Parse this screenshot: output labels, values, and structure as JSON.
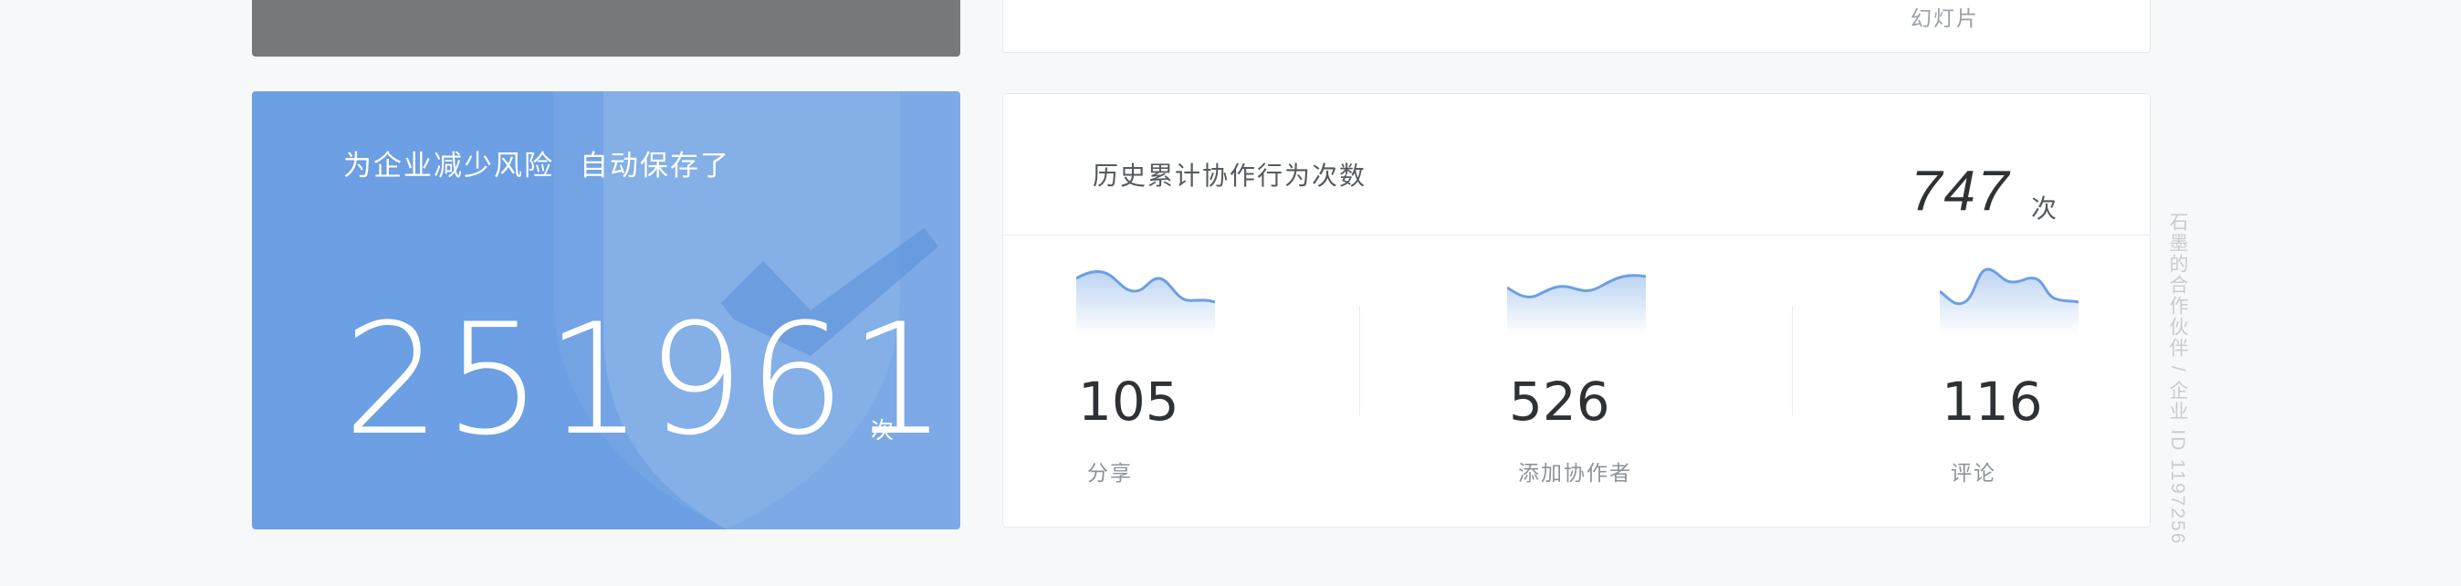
{
  "top_card": {
    "label": "幻灯片"
  },
  "risk_card": {
    "title_part1": "为企业减少风险",
    "title_part2": "自动保存了",
    "value": "251961",
    "unit": "次"
  },
  "stats_card": {
    "title": "历史累计协作行为次数",
    "total": "747",
    "total_unit": "次",
    "metrics": [
      {
        "value": "105",
        "label": "分享",
        "icon": "sparkline-chart"
      },
      {
        "value": "526",
        "label": "添加协作者",
        "icon": "sparkline-chart"
      },
      {
        "value": "116",
        "label": "评论",
        "icon": "sparkline-chart"
      }
    ]
  },
  "watermark": "石墨的合作伙伴 / 企业 ID 1197256",
  "colors": {
    "accent_blue": "#6c9fe3",
    "card_gray": "#75797c",
    "text_dark": "#2f3235",
    "text_muted": "#8d9399"
  }
}
